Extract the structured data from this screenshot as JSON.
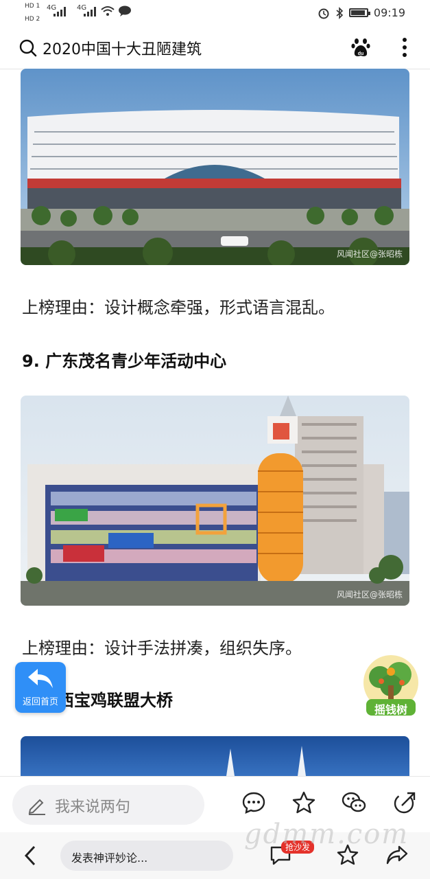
{
  "status_bar": {
    "sim1": "HD 1",
    "sim2": "HD 2",
    "net1": "4G",
    "net2": "4G",
    "time": "09:19"
  },
  "search": {
    "query": "2020中国十大丑陋建筑"
  },
  "article": {
    "image1_watermark": "风闻社区@张昭栋",
    "reason1": "上榜理由：设计概念牵强，形式语言混乱。",
    "heading9": "9. 广东茂名青少年活动中心",
    "image2_watermark": "风闻社区@张昭栋",
    "reason2": "上榜理由：设计手法拼凑，组织失序。",
    "heading8_partial": "陕西宝鸡联盟大桥"
  },
  "floating": {
    "back_home": "返回首页",
    "money_tree": "摇钱树"
  },
  "comment_bar": {
    "placeholder": "我来说两句"
  },
  "bottom_nav": {
    "post_placeholder": "发表神评妙论...",
    "sofa_badge": "抢沙发",
    "watermark": "gdmm.com"
  },
  "colors": {
    "accent_blue": "#2f8ff7",
    "badge_red": "#e4322b"
  }
}
